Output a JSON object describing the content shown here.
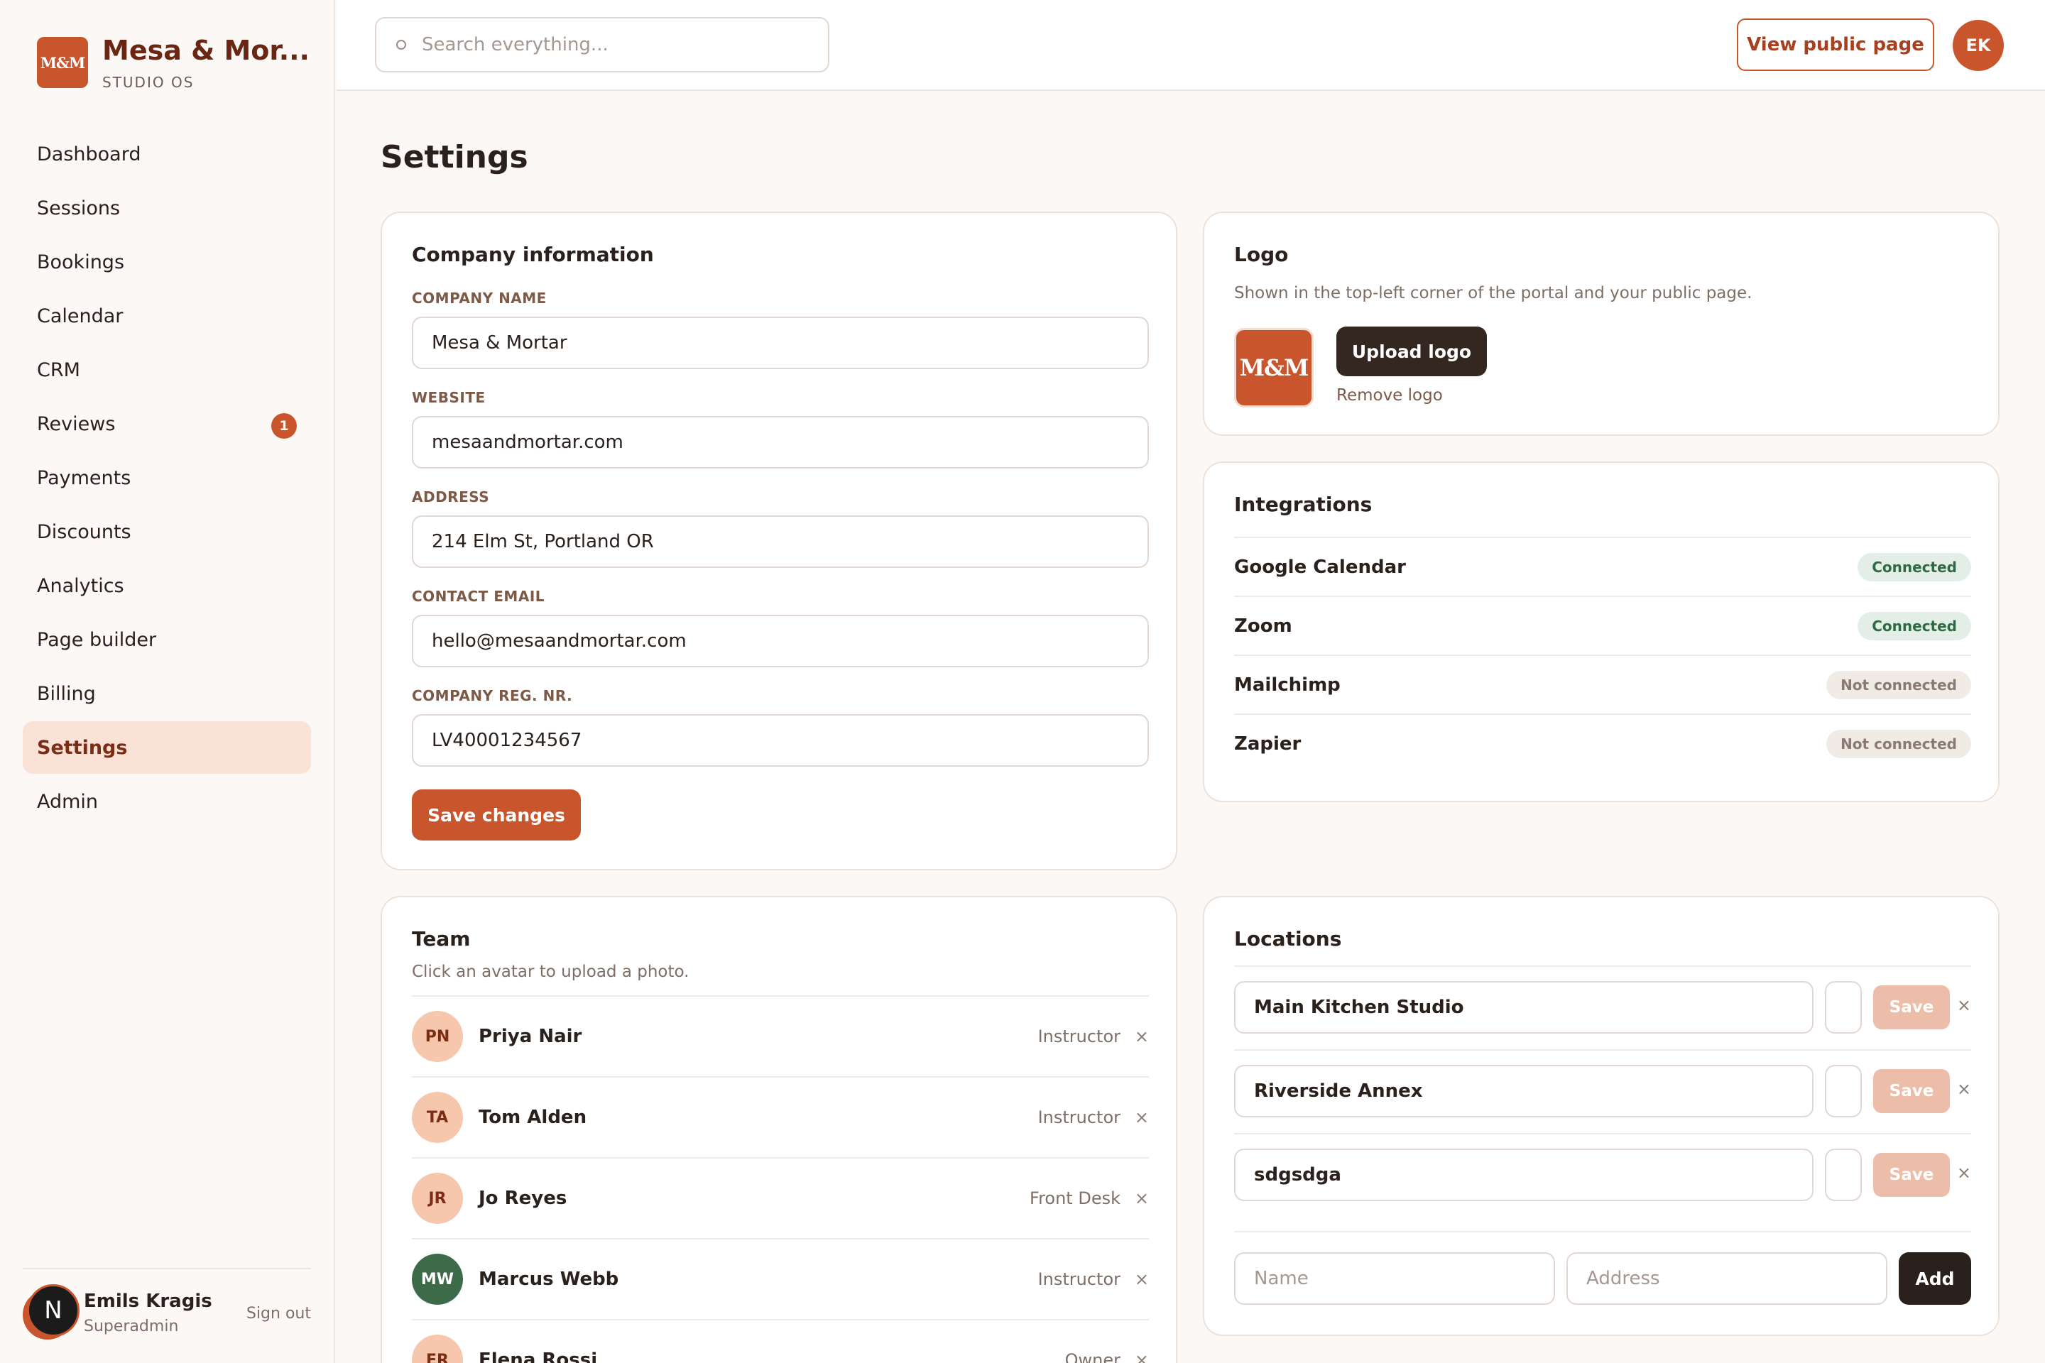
{
  "brand": {
    "logo_text": "M&M",
    "name": "Mesa & Mor...",
    "subtitle": "STUDIO OS"
  },
  "sidebar": {
    "items": [
      {
        "label": "Dashboard"
      },
      {
        "label": "Sessions"
      },
      {
        "label": "Bookings"
      },
      {
        "label": "Calendar"
      },
      {
        "label": "CRM"
      },
      {
        "label": "Reviews",
        "badge": "1"
      },
      {
        "label": "Payments"
      },
      {
        "label": "Discounts"
      },
      {
        "label": "Analytics"
      },
      {
        "label": "Page builder"
      },
      {
        "label": "Billing"
      },
      {
        "label": "Settings",
        "active": true
      },
      {
        "label": "Admin"
      }
    ],
    "user": {
      "initial": "N",
      "name": "Emils Kragis",
      "role": "Superadmin",
      "signout": "Sign out"
    }
  },
  "topbar": {
    "search_placeholder": "Search everything...",
    "public_button": "View public page",
    "avatar_initials": "EK"
  },
  "page": {
    "title": "Settings"
  },
  "company": {
    "title": "Company information",
    "fields": [
      {
        "label": "COMPANY NAME",
        "value": "Mesa & Mortar"
      },
      {
        "label": "WEBSITE",
        "value": "mesaandmortar.com"
      },
      {
        "label": "ADDRESS",
        "value": "214 Elm St, Portland OR"
      },
      {
        "label": "CONTACT EMAIL",
        "value": "hello@mesaandmortar.com"
      },
      {
        "label": "COMPANY REG. NR.",
        "value": "LV40001234567"
      }
    ],
    "save_label": "Save changes"
  },
  "logo": {
    "title": "Logo",
    "subtitle": "Shown in the top-left corner of the portal and your public page.",
    "preview_text": "M&M",
    "upload_label": "Upload logo",
    "remove_label": "Remove logo"
  },
  "integrations": {
    "title": "Integrations",
    "items": [
      {
        "name": "Google Calendar",
        "status": "Connected",
        "connected": true
      },
      {
        "name": "Zoom",
        "status": "Connected",
        "connected": true
      },
      {
        "name": "Mailchimp",
        "status": "Not connected",
        "connected": false
      },
      {
        "name": "Zapier",
        "status": "Not connected",
        "connected": false
      }
    ]
  },
  "team": {
    "title": "Team",
    "subtitle": "Click an avatar to upload a photo.",
    "remove_glyph": "×",
    "members": [
      {
        "initials": "PN",
        "name": "Priya Nair",
        "role": "Instructor"
      },
      {
        "initials": "TA",
        "name": "Tom Alden",
        "role": "Instructor"
      },
      {
        "initials": "JR",
        "name": "Jo Reyes",
        "role": "Front Desk"
      },
      {
        "initials": "MW",
        "name": "Marcus Webb",
        "role": "Instructor"
      },
      {
        "initials": "ER",
        "name": "Elena Rossi",
        "role": "Owner"
      }
    ]
  },
  "locations": {
    "title": "Locations",
    "save_label": "Save",
    "remove_glyph": "×",
    "items": [
      {
        "name": "Main Kitchen Studio",
        "address": ""
      },
      {
        "name": "Riverside Annex",
        "address": ""
      },
      {
        "name": "sdgsdga",
        "address": ""
      }
    ],
    "new_name_placeholder": "Name",
    "new_address_placeholder": "Address",
    "add_label": "Add"
  },
  "colors": {
    "accent": "#c9552c",
    "dark": "#2b211c",
    "active_nav": "#fbe2d6",
    "connected_bg": "#e3efe6"
  }
}
